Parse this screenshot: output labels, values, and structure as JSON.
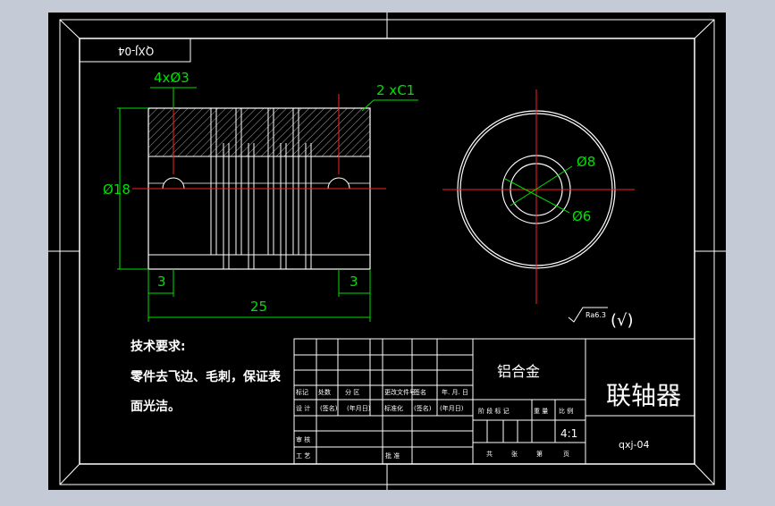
{
  "drawing": {
    "part_code_flipped": "QXJ-04",
    "part_code": "qxj-04",
    "material": "铝合金",
    "part_name": "联轴器",
    "scale": "4:1"
  },
  "dimensions": {
    "holes": "4xØ3",
    "chamfer": "2 xC1",
    "outer_diameter": "Ø18",
    "left_offset": "3",
    "right_offset": "3",
    "length": "25",
    "bore_outer": "Ø8",
    "bore_inner": "Ø6"
  },
  "surface_finish": {
    "value": "Ra6.3",
    "bracket": "(√)"
  },
  "notes": {
    "title": "技术要求:",
    "line1": "零件去飞边、毛刺，保证表",
    "line2": "面光洁。"
  },
  "title_block": {
    "mark": "标记",
    "count": "处数",
    "zone": "分  区",
    "change_doc": "更改文件号",
    "sign": "签名",
    "date": "年. 月. 日",
    "design": "设  计",
    "sign_paren": "(签名)",
    "date_paren": "(年月日)",
    "standardize": "标准化",
    "stage_mark": "阶 段 标 记",
    "weight": "重 量",
    "scale_label": "比 例",
    "check": "审  核",
    "process": "工  艺",
    "approve": "批  准",
    "total": "共",
    "sheets": "张",
    "page": "第",
    "sheet": "页"
  }
}
